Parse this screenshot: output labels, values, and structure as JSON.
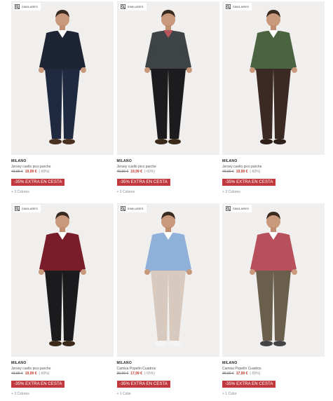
{
  "similar_label": "SIMILARES",
  "products": [
    {
      "brand": "MILANO",
      "name": "Jersey cuello pico parche",
      "old_price": "49,99 €",
      "new_price": "19,99 €",
      "discount": "(-60%)",
      "promo": "-35% EXTRA EN CESTA",
      "colors": "+ 3 Colores",
      "top_color": "#1d2433",
      "bottom_color": "#1f2a40",
      "under_color": "#ffffff",
      "shoe_color": "#4a3020"
    },
    {
      "brand": "MILANO",
      "name": "Jersey cuello pico parche",
      "old_price": "49,99 €",
      "new_price": "19,99 €",
      "discount": "(-60%)",
      "promo": "-35% EXTRA EN CESTA",
      "colors": "+ 3 Colores",
      "top_color": "#3e4346",
      "bottom_color": "#1c1c1e",
      "under_color": "#b7575c",
      "shoe_color": "#3a2818"
    },
    {
      "brand": "MILANO",
      "name": "Jersey cuello pico parche",
      "old_price": "49,99 €",
      "new_price": "19,99 €",
      "discount": "(-60%)",
      "promo": "-35% EXTRA EN CESTA",
      "colors": "+ 3 Colores",
      "top_color": "#4a6340",
      "bottom_color": "#3b2a24",
      "under_color": "#ffffff",
      "shoe_color": "#2e2018"
    },
    {
      "brand": "MILANO",
      "name": "Jersey cuello pico parche",
      "old_price": "49,99 €",
      "new_price": "19,99 €",
      "discount": "(-60%)",
      "promo": "-35% EXTRA EN CESTA",
      "colors": "+ 3 Colores",
      "top_color": "#7a1d2a",
      "bottom_color": "#1b1b1d",
      "under_color": "#ffffff",
      "shoe_color": "#3a2818"
    },
    {
      "brand": "MILANO",
      "name": "Camisa Popelín Cuadros",
      "old_price": "39,99 €",
      "new_price": "17,99 €",
      "discount": "(-55%)",
      "promo": "-35% EXTRA EN CESTA",
      "colors": "+ 1 Color",
      "top_color": "#8fb0d9",
      "bottom_color": "#d8c9bf",
      "under_color": "#ffffff",
      "shoe_color": "#f4f4f4"
    },
    {
      "brand": "MILANO",
      "name": "Camisa Popelín Cuadros",
      "old_price": "39,99 €",
      "new_price": "17,99 €",
      "discount": "(-55%)",
      "promo": "-35% EXTRA EN CESTA",
      "colors": "+ 1 Color",
      "top_color": "#b7505b",
      "bottom_color": "#6a5f4c",
      "under_color": "#ffffff",
      "shoe_color": "#444"
    }
  ]
}
